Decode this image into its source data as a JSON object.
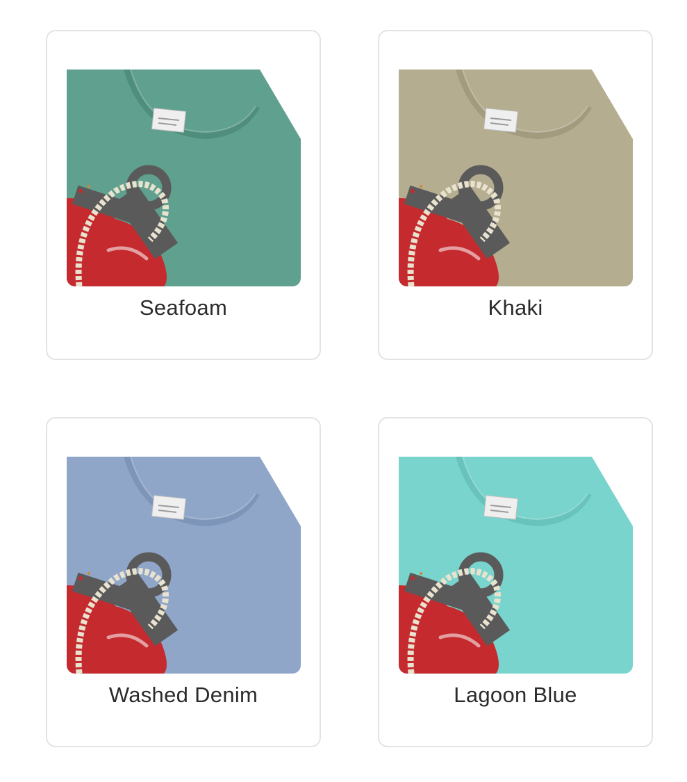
{
  "swatches": [
    {
      "label": "Seafoam",
      "color": "#5fa08e",
      "shade": "#4f8e7d"
    },
    {
      "label": "Khaki",
      "color": "#b4ad8f",
      "shade": "#a29b7e"
    },
    {
      "label": "Washed Denim",
      "color": "#8fa6c8",
      "shade": "#7d95b9"
    },
    {
      "label": "Lagoon Blue",
      "color": "#78d4cc",
      "shade": "#67c3bb"
    }
  ],
  "thumbnail": {
    "graphic_icon": "anchor-heart-graphic-icon",
    "tag_icon": "neck-tag-icon",
    "heart_color": "#c42a2e",
    "rope_color": "#e8e2cf",
    "anchor_color": "#5a5a5a"
  }
}
